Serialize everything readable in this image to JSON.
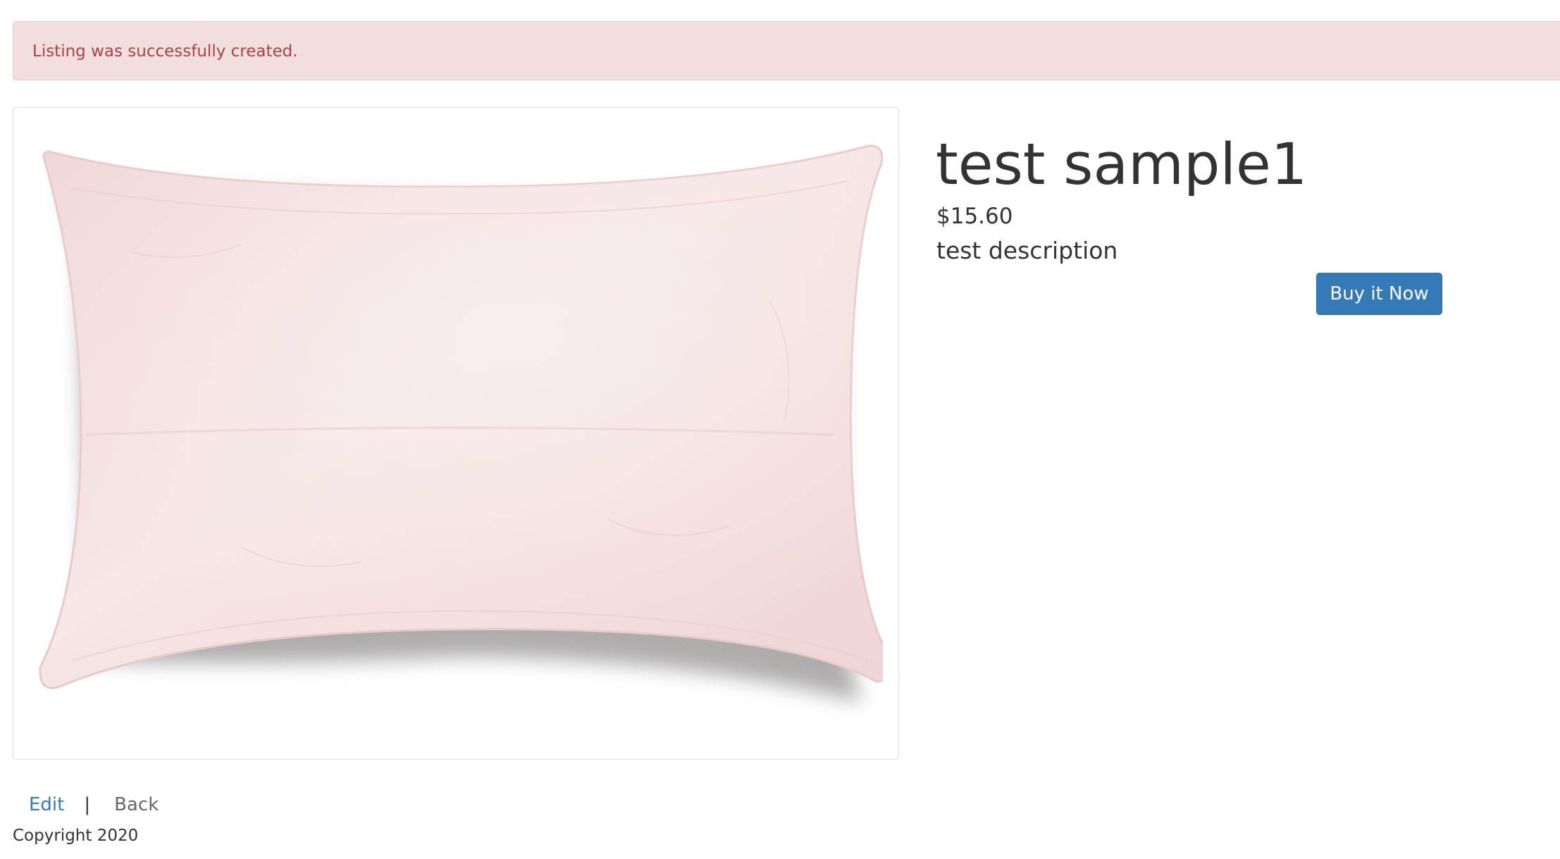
{
  "flash": {
    "notice": "Listing was successfully created."
  },
  "listing": {
    "title": "test sample1",
    "price": "$15.60",
    "description": "test description",
    "image_subject": "pink pillow",
    "buy_label": "Buy it Now"
  },
  "actions": {
    "edit_label": "Edit",
    "separator": "|",
    "back_label": "Back"
  },
  "footer": {
    "copyright": "Copyright 2020"
  },
  "colors": {
    "alert_bg": "#f2dede",
    "alert_text": "#a94442",
    "primary": "#337ab7",
    "pillow": "#f3dcdd"
  },
  "icons": {
    "listing_image": "pillow-image"
  }
}
